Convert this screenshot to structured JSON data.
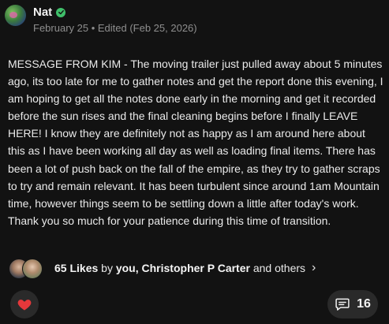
{
  "post": {
    "author": "Nat",
    "date_line": "February 25 • Edited (Feb 25, 2026)",
    "body": "MESSAGE FROM KIM - The moving trailer just pulled away about 5 minutes ago, its too late for me to gather notes and get the report done this evening, I am hoping to get all the notes done early in the morning and get it recorded before the sun rises and the final cleaning begins before I finally LEAVE HERE! I know they are definitely not as happy as I am around here about this as I have been working all day as well as loading final items. There has been a lot of push back on the fall of the empire, as they try to gather scraps to try and remain relevant. It has been turbulent since around 1am Mountain time, however things seem to be settling down a little after today's work. Thank you so much for your patience during this time of transition."
  },
  "likes": {
    "count_label": "65 Likes",
    "by_label": "by",
    "names": "you, Christopher P Carter",
    "others_label": "and others",
    "chevron": "›"
  },
  "actions": {
    "heart_icon": "heart-icon",
    "heart_color": "#e5383b",
    "comment_icon": "comment-icon",
    "comment_count": "16"
  },
  "colors": {
    "background": "#121212",
    "verified": "#3fbf6a"
  }
}
